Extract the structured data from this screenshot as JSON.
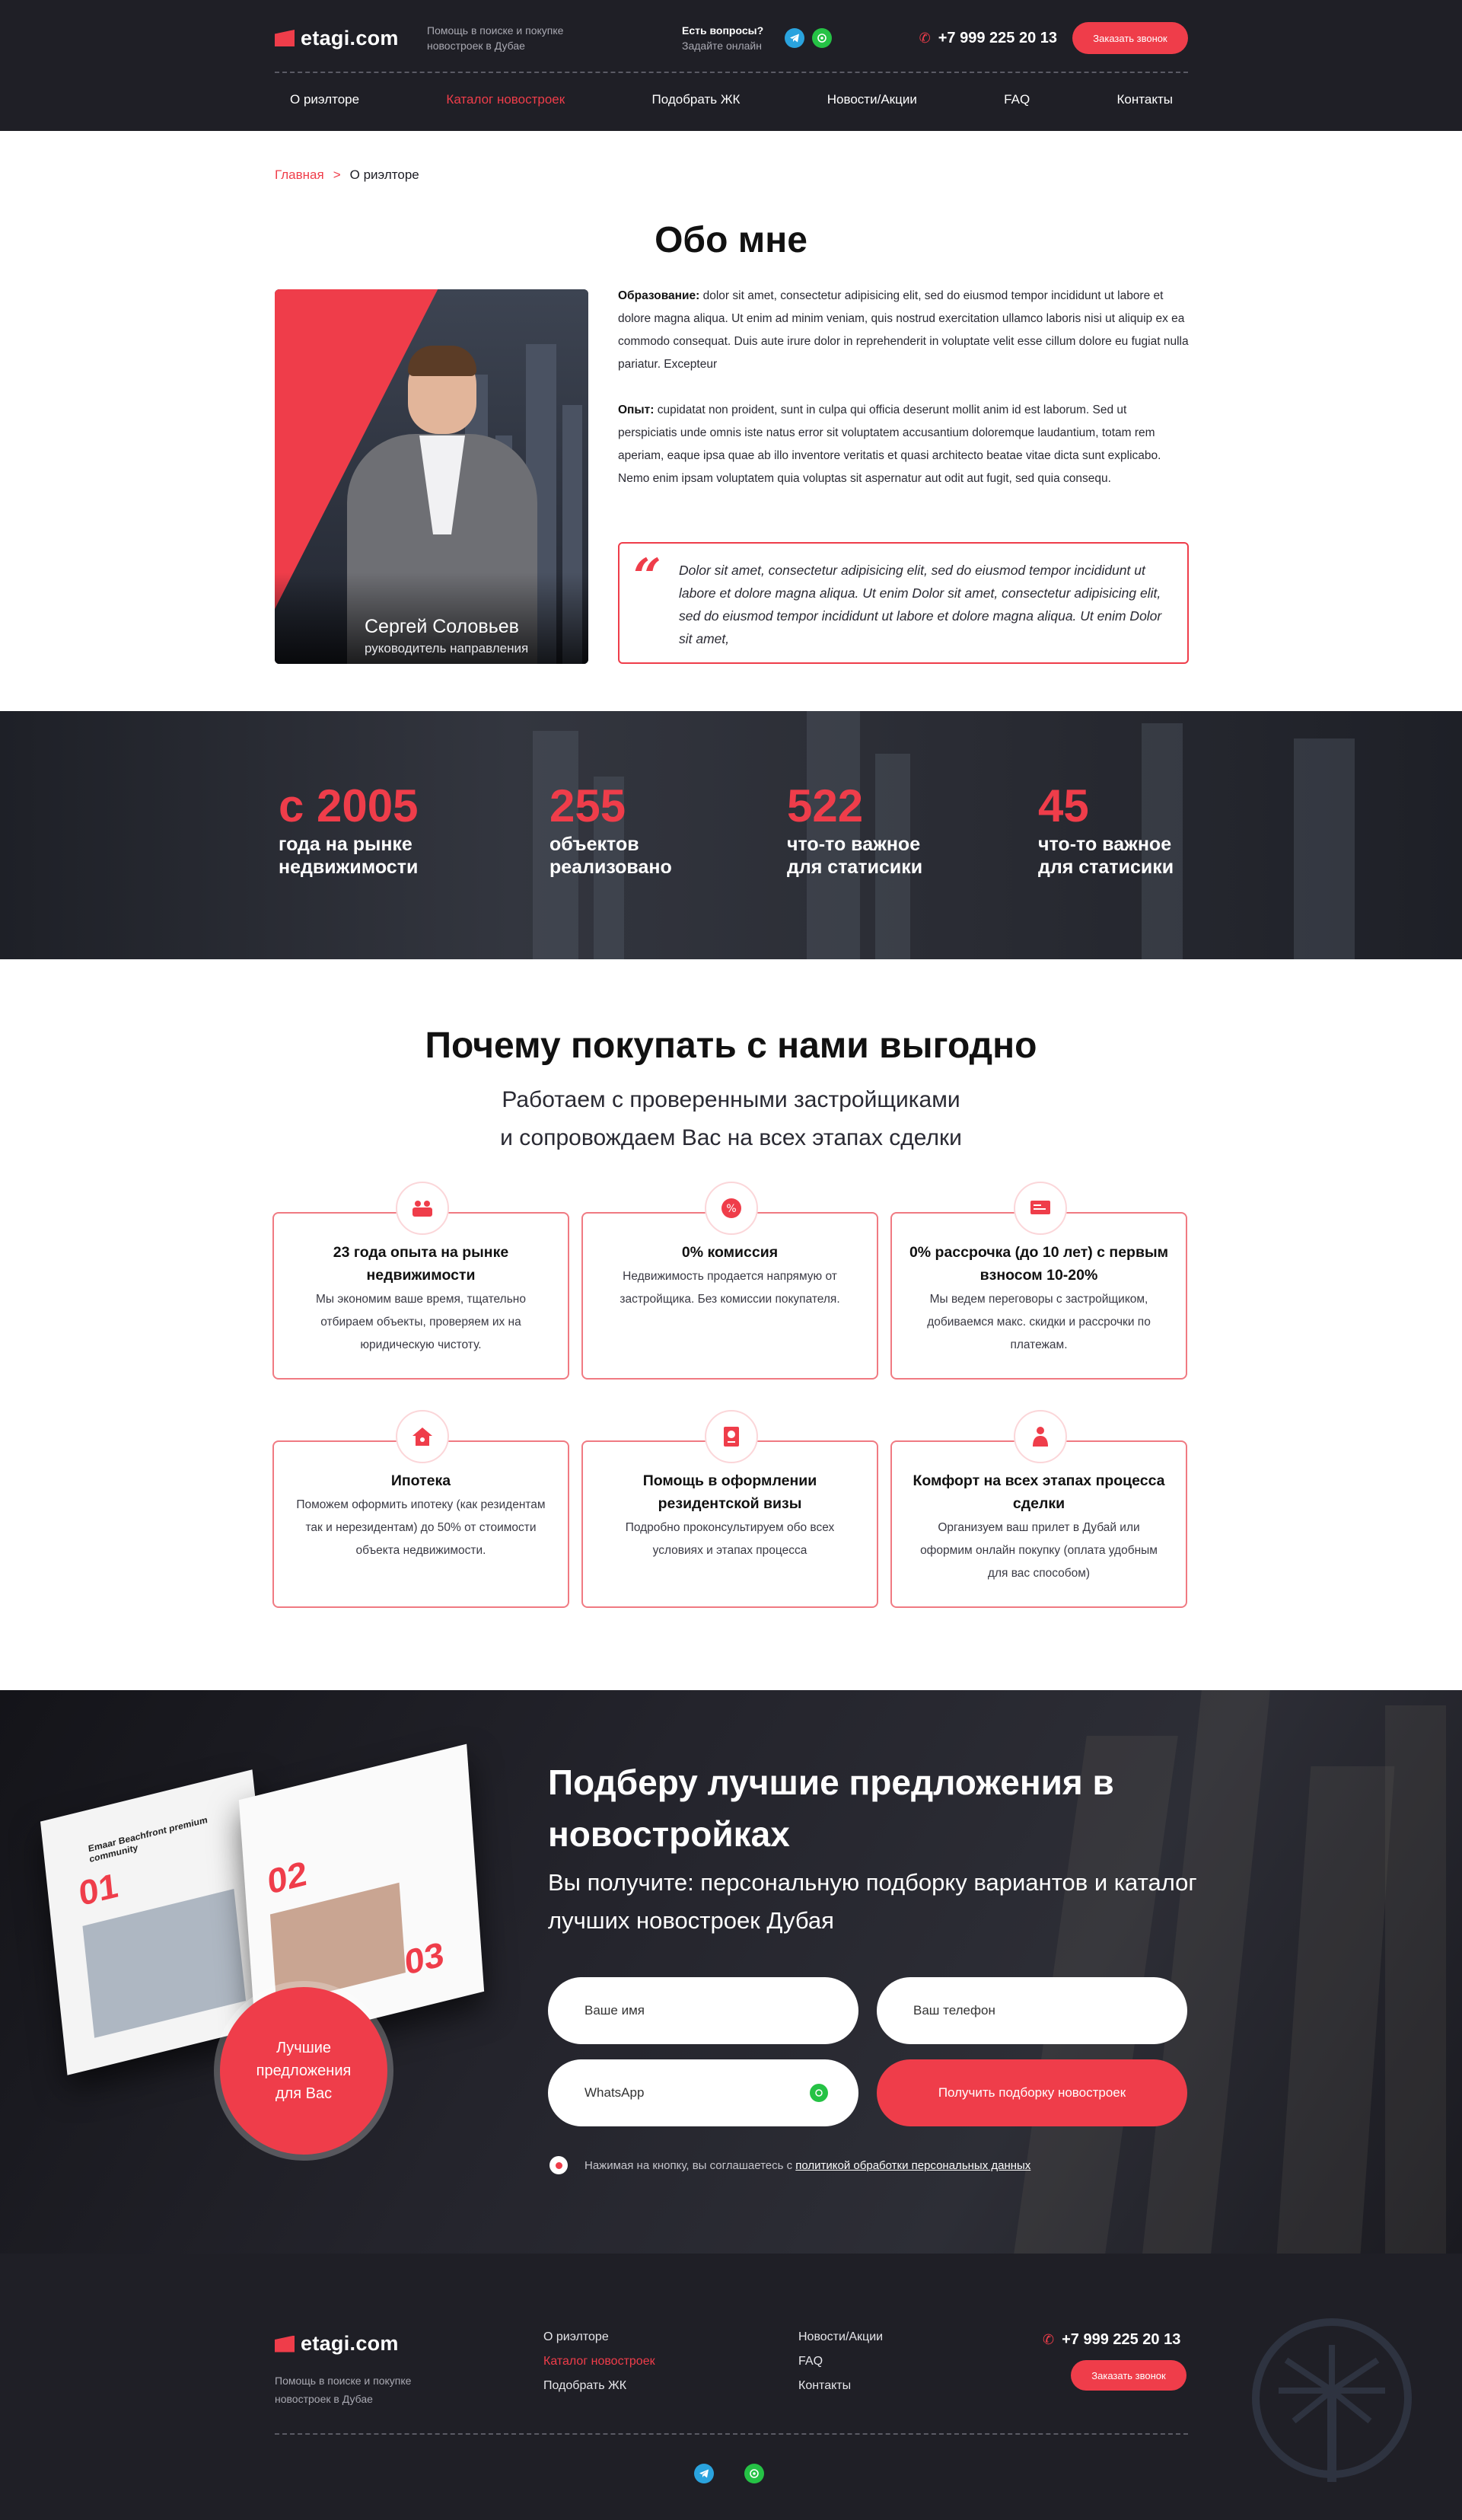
{
  "header": {
    "logo": "etagi.com",
    "tagline": "Помощь в поиске и покупке новостроек в Дубае",
    "question": "Есть вопросы?",
    "question_sub": "Задайте онлайн",
    "phone": "+7 999 225 20 13",
    "call_button": "Заказать звонок",
    "nav": [
      {
        "label": "О риэлторе",
        "active": false
      },
      {
        "label": "Каталог новостроек",
        "active": true
      },
      {
        "label": "Подобрать  ЖК",
        "active": false
      },
      {
        "label": "Новости/Акции",
        "active": false
      },
      {
        "label": "FAQ",
        "active": false
      },
      {
        "label": "Контакты",
        "active": false
      }
    ]
  },
  "breadcrumb": {
    "home": "Главная",
    "sep": ">",
    "current": "О риэлторе"
  },
  "about": {
    "title": "Обо мне",
    "name": "Сергей Соловьев",
    "role": "руководитель направления",
    "education_label": "Образование:",
    "education_text": " dolor sit amet, consectetur adipisicing elit, sed do eiusmod tempor incididunt ut labore et dolore magna aliqua. Ut enim ad minim veniam, quis nostrud exercitation ullamco laboris nisi ut aliquip ex ea commodo consequat. Duis aute irure dolor in reprehenderit in voluptate velit esse cillum dolore eu fugiat nulla pariatur. Excepteur",
    "experience_label": "Опыт:",
    "experience_text": " cupidatat non proident, sunt in culpa qui officia deserunt mollit anim id est laborum. Sed ut perspiciatis unde omnis iste natus error sit voluptatem accusantium doloremque laudantium, totam rem aperiam, eaque ipsa quae ab illo inventore veritatis et quasi architecto beatae vitae dicta sunt explicabo. Nemo enim ipsam voluptatem quia voluptas sit aspernatur aut odit aut fugit, sed quia consequ.",
    "quote": "Dolor sit amet, consectetur adipisicing elit, sed do eiusmod tempor incididunt ut labore et dolore magna aliqua. Ut enim  Dolor sit amet, consectetur adipisicing elit, sed do eiusmod tempor incididunt ut labore et dolore magna aliqua. Ut enim  Dolor sit amet,"
  },
  "stats": [
    {
      "value": "с 2005",
      "label": "года на рынке недвижимости"
    },
    {
      "value": "255",
      "label": "объектов реализовано"
    },
    {
      "value": "522",
      "label": "что-то важное для статисики"
    },
    {
      "value": "45",
      "label": "что-то важное для статисики"
    }
  ],
  "why": {
    "title": "Почему покупать с нами выгодно",
    "subtitle_1": "Работаем с проверенными застройщиками",
    "subtitle_2": "и сопровождаем Вас на всех этапах сделки",
    "cards": [
      {
        "icon": "handshake-icon",
        "title": "23 года опыта на рынке недвижимости",
        "text": "Мы экономим ваше время, тщательно отбираем объекты, проверяем их на юридическую чистоту."
      },
      {
        "icon": "percent-icon",
        "title": "0% комиссия",
        "text": "Недвижимость продается напрямую от застройщика. Без комиссии покупателя."
      },
      {
        "icon": "installment-icon",
        "title": "0% рассрочка (до 10 лет) с первым взносом 10-20%",
        "text": "Мы ведем переговоры с застройщиком, добиваемся макс. скидки и рассрочки по платежам."
      },
      {
        "icon": "house-icon",
        "title": "Ипотека",
        "text": "Поможем оформить ипотеку (как резидентам так и нерезидентам) до 50% от стоимости объекта недвижимости."
      },
      {
        "icon": "passport-icon",
        "title": "Помощь в оформлении резидентской визы",
        "text": "Подробно проконсультируем обо всех условиях и этапах процесса"
      },
      {
        "icon": "comfort-icon",
        "title": "Комфорт на всех этапах процесса сделки",
        "text": "Организуем ваш прилет в Дубай или оформим онлайн покупку (оплата удобным для вас способом)"
      }
    ]
  },
  "lead": {
    "title": "Подберу лучшие предложения в новостройках",
    "subtitle": "Вы получите: персональную подборку вариантов и каталог лучших новостроек Дубая",
    "magazine_heading": "Emaar Beachfront premium community",
    "magazine_numbers": [
      "01",
      "02",
      "03"
    ],
    "badge": "Лучшие предложения для Вас",
    "name_placeholder": "Ваше имя",
    "phone_placeholder": "Ваш телефон",
    "messenger_value": "WhatsApp",
    "submit": "Получить подборку новостроек",
    "consent_text": "Нажимая на кнопку, вы соглашаетесь с ",
    "consent_link": "политикой обработки персональных данных"
  },
  "footer": {
    "logo": "etagi.com",
    "tagline": "Помощь в поиске и покупке новостроек в Дубае",
    "col1": [
      {
        "label": "О риэлторе",
        "active": false
      },
      {
        "label": "Каталог новостроек",
        "active": true
      },
      {
        "label": "Подобрать  ЖК",
        "active": false
      }
    ],
    "col2": [
      {
        "label": "Новости/Акции",
        "active": false
      },
      {
        "label": "FAQ",
        "active": false
      },
      {
        "label": "Контакты",
        "active": false
      }
    ],
    "phone": "+7 999 225 20 13",
    "call_button": "Заказать звонок"
  },
  "colors": {
    "accent": "#ef3d4a",
    "dark": "#1f1f26",
    "telegram": "#2aa3de",
    "whatsapp": "#25c245"
  }
}
